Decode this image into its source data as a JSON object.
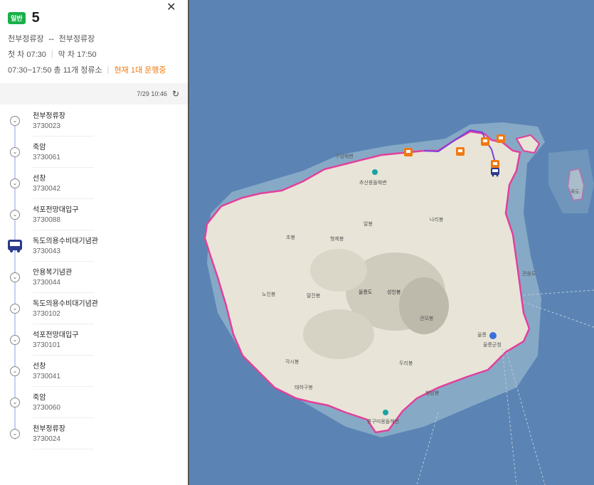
{
  "route": {
    "badge": "일반",
    "number": "5",
    "terminals_from": "천부정류장",
    "terminals_arrow": "↔",
    "terminals_to": "천부정류장",
    "first_label": "첫 차 07:30",
    "last_label": "막 차 17:50",
    "schedule": "07:30~17:50 총 11개 정류소",
    "running": "현재 1대 운행중"
  },
  "update": {
    "time": "7/29 10:46",
    "refresh_icon": "↻"
  },
  "close_icon": "✕",
  "stops": [
    {
      "name": "천부정류장",
      "id": "3730023"
    },
    {
      "name": "죽암",
      "id": "3730061"
    },
    {
      "name": "선창",
      "id": "3730042"
    },
    {
      "name": "석포전망대입구",
      "id": "3730088"
    },
    {
      "name": "독도의용수비대기념관",
      "id": "3730043"
    },
    {
      "name": "안용복기념관",
      "id": "3730044"
    },
    {
      "name": "독도의용수비대기념관",
      "id": "3730102"
    },
    {
      "name": "석포전망대입구",
      "id": "3730101"
    },
    {
      "name": "선창",
      "id": "3730041"
    },
    {
      "name": "죽암",
      "id": "3730060"
    },
    {
      "name": "천부정류장",
      "id": "3730024"
    }
  ],
  "map": {
    "labels": {
      "l1": "구암해변",
      "l2": "추산몽돌해변",
      "l3": "알봉",
      "l4": "나리봉",
      "l5": "초봉",
      "l6": "형제봉",
      "l7": "노인봉",
      "l8": "말잔봉",
      "l9": "울릉도",
      "l10": "성인봉",
      "l11": "관모봉",
      "l12": "울릉군청",
      "l13": "각시봉",
      "l14": "두리봉",
      "l15": "태하구봉",
      "l16": "통구미몽돌해변",
      "l17": "관음도",
      "l18": "죽도",
      "l19": "죽도",
      "l20": "울릉",
      "l21": "행남봉",
      "l22": "관음"
    }
  }
}
